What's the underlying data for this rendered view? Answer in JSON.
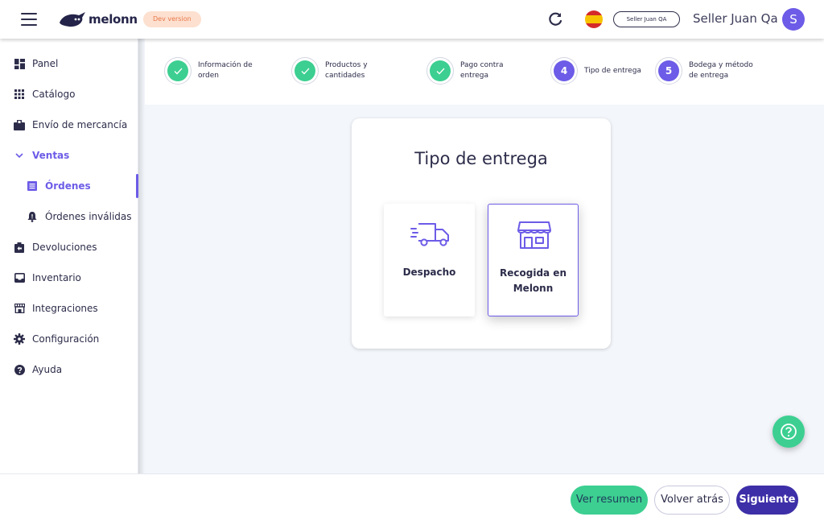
{
  "topbar": {
    "logo_text": "melonn",
    "dev_badge": "Dev version",
    "seller_pill": "Seller Juan QA",
    "user_name": "Seller Juan Qa",
    "avatar_initial": "S"
  },
  "sidebar": {
    "items": [
      {
        "label": "Panel",
        "icon": "dashboard-icon"
      },
      {
        "label": "Catálogo",
        "icon": "grid-icon"
      },
      {
        "label": "Envío de mercancía",
        "icon": "package-icon"
      },
      {
        "label": "Ventas",
        "icon": "chevron-down-icon"
      },
      {
        "label": "Órdenes",
        "icon": "document-icon"
      },
      {
        "label": "Órdenes inválidas",
        "icon": "bell-icon"
      },
      {
        "label": "Devoluciones",
        "icon": "return-icon"
      },
      {
        "label": "Inventario",
        "icon": "inbox-icon"
      },
      {
        "label": "Integraciones",
        "icon": "store-icon"
      },
      {
        "label": "Configuración",
        "icon": "gear-icon"
      },
      {
        "label": "Ayuda",
        "icon": "help-icon"
      }
    ]
  },
  "stepper": {
    "steps": [
      {
        "label": "Información de orden",
        "status": "done"
      },
      {
        "label": "Productos y cantidades",
        "status": "done"
      },
      {
        "label": "Pago contra entrega",
        "status": "done"
      },
      {
        "label": "Tipo de entrega",
        "status": "current",
        "number": "4"
      },
      {
        "label": "Bodega y método de entrega",
        "status": "pending",
        "number": "5"
      }
    ]
  },
  "main": {
    "title": "Tipo de entrega",
    "options": [
      {
        "label": "Despacho",
        "icon": "truck-icon",
        "selected": false
      },
      {
        "label": "Recogida en Melonn",
        "icon": "store-icon",
        "selected": true
      }
    ]
  },
  "footer": {
    "ver_resumen": "Ver resumen",
    "volver_atras": "Volver atrás",
    "siguiente": "Siguiente"
  },
  "colors": {
    "accent": "#6c5ce7",
    "success": "#3ccf91",
    "primary_dark": "#3d2fa8",
    "dev_badge_bg": "#fde0cf"
  }
}
